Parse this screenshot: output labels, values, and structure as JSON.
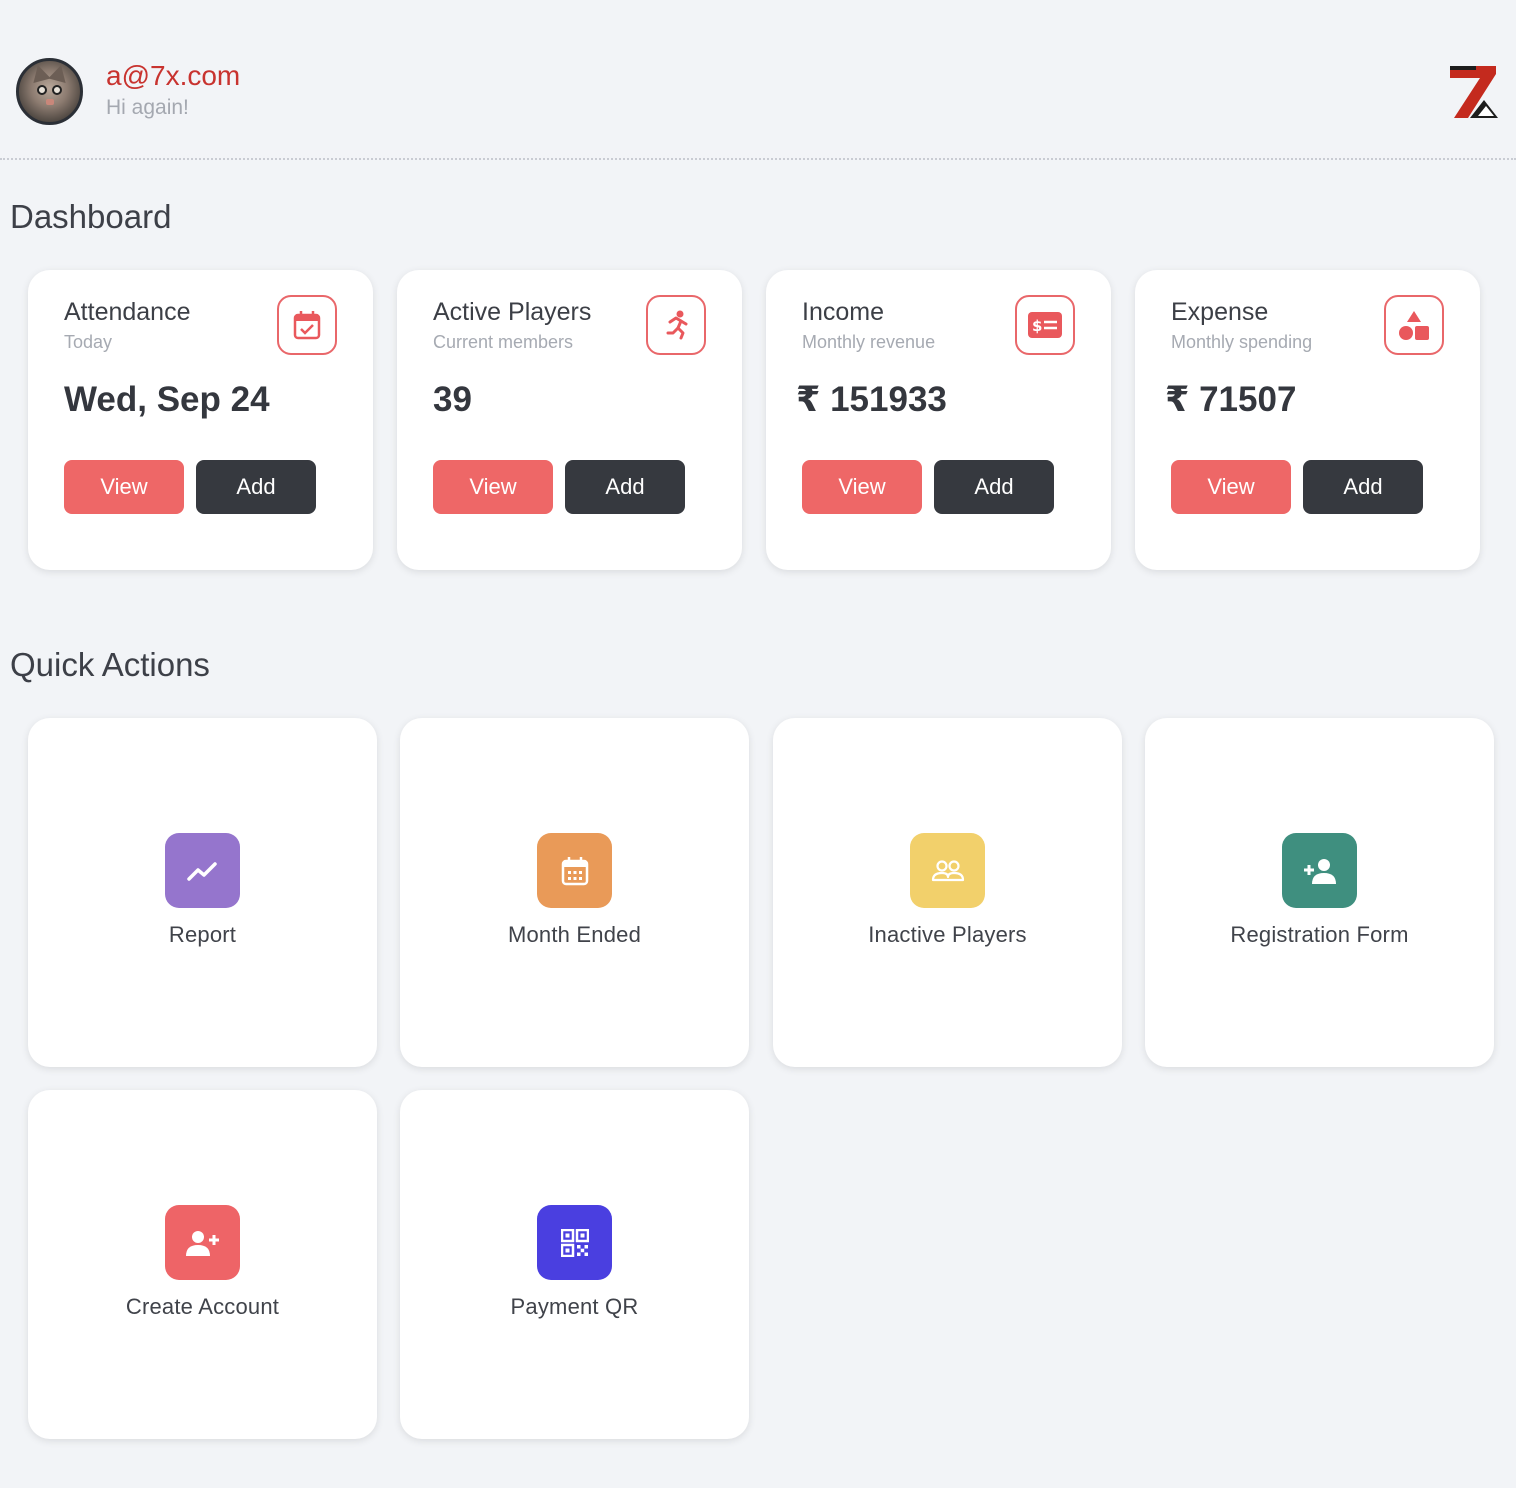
{
  "header": {
    "email": "a@7x.com",
    "greeting": "Hi again!",
    "avatar": "cat-avatar",
    "logo": "7x-logo"
  },
  "dashboard": {
    "title": "Dashboard",
    "cards": [
      {
        "title": "Attendance",
        "subtitle": "Today",
        "value": "Wed, Sep 24",
        "icon": "calendar-check-icon",
        "view_label": "View",
        "add_label": "Add"
      },
      {
        "title": "Active Players",
        "subtitle": "Current members",
        "value": "39",
        "icon": "running-person-icon",
        "view_label": "View",
        "add_label": "Add"
      },
      {
        "title": "Income",
        "subtitle": "Monthly revenue",
        "value": "₹ 151933",
        "icon": "money-bill-icon",
        "view_label": "View",
        "add_label": "Add"
      },
      {
        "title": "Expense",
        "subtitle": "Monthly spending",
        "value": "₹ 71507",
        "icon": "shapes-icon",
        "view_label": "View",
        "add_label": "Add"
      }
    ]
  },
  "quick_actions": {
    "title": "Quick Actions",
    "items": [
      {
        "label": "Report",
        "icon": "chart-line-icon",
        "color": "#9575cd"
      },
      {
        "label": "Month Ended",
        "icon": "calendar-icon",
        "color": "#e99a58"
      },
      {
        "label": "Inactive Players",
        "icon": "users-icon",
        "color": "#f2d06b"
      },
      {
        "label": "Registration Form",
        "icon": "user-plus-icon",
        "color": "#3f8f7f"
      },
      {
        "label": "Create Account",
        "icon": "user-add-icon",
        "color": "#ee6467"
      },
      {
        "label": "Payment QR",
        "icon": "qr-code-icon",
        "color": "#4a3fe0"
      }
    ]
  },
  "colors": {
    "accent_red": "#ee6767",
    "dark_button": "#36393f",
    "email_red": "#c8332f"
  }
}
